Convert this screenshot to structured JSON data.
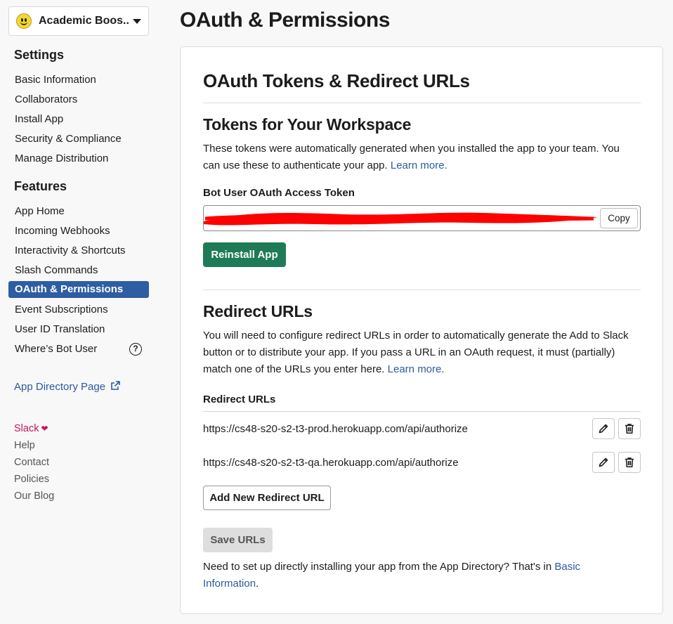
{
  "app": {
    "name": "Academic Boos..."
  },
  "sidebar": {
    "settings_heading": "Settings",
    "settings_items": [
      {
        "label": "Basic Information"
      },
      {
        "label": "Collaborators"
      },
      {
        "label": "Install App"
      },
      {
        "label": "Security & Compliance"
      },
      {
        "label": "Manage Distribution"
      }
    ],
    "features_heading": "Features",
    "features_items": [
      {
        "label": "App Home"
      },
      {
        "label": "Incoming Webhooks"
      },
      {
        "label": "Interactivity & Shortcuts"
      },
      {
        "label": "Slash Commands"
      },
      {
        "label": "OAuth & Permissions",
        "active": true
      },
      {
        "label": "Event Subscriptions"
      },
      {
        "label": "User ID Translation"
      },
      {
        "label": "Where’s Bot User"
      }
    ],
    "help_icon_text": "?",
    "app_directory_link": "App Directory Page",
    "footer": {
      "slack": "Slack",
      "help": "Help",
      "contact": "Contact",
      "policies": "Policies",
      "blog": "Our Blog"
    }
  },
  "page": {
    "title": "OAuth & Permissions"
  },
  "card": {
    "title": "OAuth Tokens & Redirect URLs",
    "tokens": {
      "heading": "Tokens for Your Workspace",
      "desc": "These tokens were automatically generated when you installed the app to your team. You can use these to authenticate your app.",
      "learn_more": "Learn more.",
      "token_label": "Bot User OAuth Access Token",
      "copy_label": "Copy",
      "reinstall_label": "Reinstall App"
    },
    "redirect": {
      "heading": "Redirect URLs",
      "desc": "You will need to configure redirect URLs in order to automatically generate the Add to Slack button or to distribute your app. If you pass a URL in an OAuth request, it must (partially) match one of the URLs you enter here.",
      "learn_more": "Learn more.",
      "list_label": "Redirect URLs",
      "urls": [
        "https://cs48-s20-s2-t3-prod.herokuapp.com/api/authorize",
        "https://cs48-s20-s2-t3-qa.herokuapp.com/api/authorize"
      ],
      "add_label": "Add New Redirect URL",
      "save_label": "Save URLs",
      "footer_text": "Need to set up directly installing your app from the App Directory? That's in",
      "footer_link": "Basic Information",
      "footer_end": "."
    }
  },
  "colors": {
    "accent_blue": "#2f5da3",
    "link": "#2b5b9c",
    "green_button": "#1f7a57",
    "redaction": "#ff0000"
  }
}
